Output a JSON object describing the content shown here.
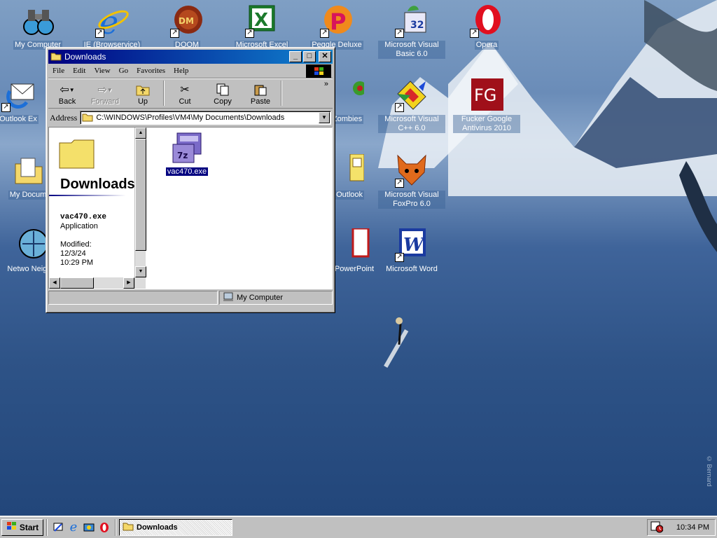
{
  "desktop": {
    "icons": [
      {
        "label": "My Computer",
        "icon": "binoculars-icon",
        "shortcut": false
      },
      {
        "label": "IE (Browservice)",
        "icon": "internet-explorer-icon",
        "shortcut": true
      },
      {
        "label": "DOOM",
        "icon": "doom-icon",
        "shortcut": true
      },
      {
        "label": "Microsoft Excel",
        "icon": "excel-icon",
        "shortcut": true
      },
      {
        "label": "Peggle Deluxe",
        "icon": "peggle-icon",
        "shortcut": true
      },
      {
        "label": "Microsoft Visual Basic 6.0",
        "icon": "visual-basic-icon",
        "shortcut": true
      },
      {
        "label": "Opera",
        "icon": "opera-icon",
        "shortcut": true
      },
      {
        "label": "Outlook Express",
        "icon": "outlook-express-icon",
        "shortcut": true,
        "visible_label": "Outlook Ex"
      },
      {
        "label": "Plants vs. Zombies",
        "icon": "pvz-icon",
        "shortcut": true,
        "visible_label": "Zombies"
      },
      {
        "label": "Microsoft Visual C++ 6.0",
        "icon": "visual-cpp-icon",
        "shortcut": true
      },
      {
        "label": "Fucker Google Antivirus 2010",
        "icon": "fg-antivirus-icon",
        "shortcut": false
      },
      {
        "label": "My Documents",
        "icon": "my-documents-icon",
        "shortcut": false,
        "visible_label": "My Docum"
      },
      {
        "label": "Microsoft Outlook",
        "icon": "outlook-icon",
        "shortcut": true,
        "visible_label": "t Outlook"
      },
      {
        "label": "Microsoft Visual FoxPro 6.0",
        "icon": "foxpro-icon",
        "shortcut": true
      },
      {
        "label": "Network Neighborhood",
        "icon": "network-icon",
        "shortcut": false,
        "visible_label": "Netwo Neighbo"
      },
      {
        "label": "Microsoft PowerPoint",
        "icon": "powerpoint-icon",
        "shortcut": true,
        "visible_label": "PowerPoint"
      },
      {
        "label": "Microsoft Word",
        "icon": "word-icon",
        "shortcut": true
      }
    ],
    "watermark": "© Bernard"
  },
  "window": {
    "title": "Downloads",
    "menu": [
      "File",
      "Edit",
      "View",
      "Go",
      "Favorites",
      "Help"
    ],
    "toolbar": {
      "back": "Back",
      "forward": "Forward",
      "up": "Up",
      "cut": "Cut",
      "copy": "Copy",
      "paste": "Paste"
    },
    "address": {
      "label": "Address",
      "value": "C:\\WINDOWS\\Profiles\\VM4\\My Documents\\Downloads"
    },
    "webview": {
      "heading": "Downloads",
      "selected_name": "vac470.exe",
      "selected_type": "Application",
      "modified_label": "Modified:",
      "modified_date": "12/3/24",
      "modified_time": "10:29 PM"
    },
    "files": [
      {
        "name": "vac470.exe",
        "icon": "7zip-sfx-icon",
        "selected": true
      }
    ],
    "status": {
      "left": "",
      "location": "My Computer"
    }
  },
  "taskbar": {
    "start_label": "Start",
    "quick_launch": [
      "show-desktop-icon",
      "internet-explorer-icon",
      "channels-icon",
      "opera-icon"
    ],
    "tasks": [
      {
        "label": "Downloads",
        "active": true
      }
    ],
    "clock": "10:34 PM"
  },
  "colors": {
    "titlebar_start": "#000080",
    "titlebar_end": "#1084d0",
    "selection": "#000080",
    "face": "#c0c0c0"
  }
}
